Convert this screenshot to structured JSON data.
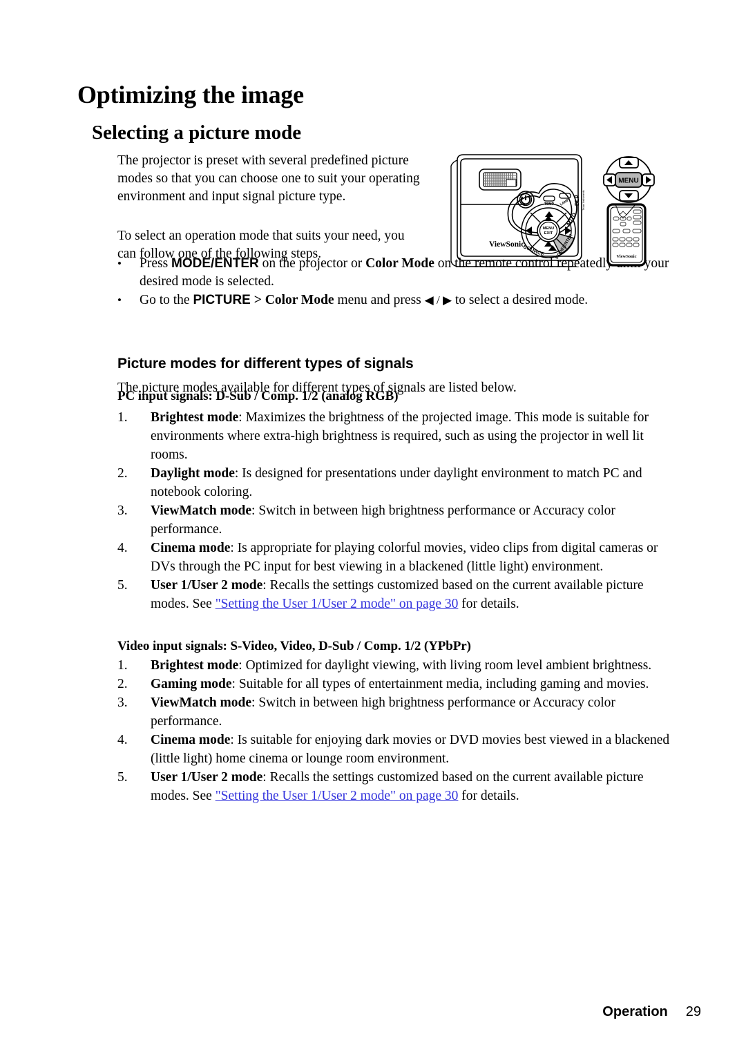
{
  "page": {
    "title": "Optimizing the image",
    "section_title": "Selecting a picture mode",
    "footer_label": "Operation",
    "footer_page": "29"
  },
  "intro": {
    "paragraph1": "The projector is preset with several predefined picture modes so that you can choose one to suit your operating environment and input signal picture type.",
    "paragraph2": "To select an operation mode that suits your need, you can follow one of the following steps."
  },
  "bullets": [
    {
      "marker": "•",
      "pre": "Press ",
      "key1": "MODE/ENTER",
      "mid": " on the projector or ",
      "key2": "Color Mode",
      "post": " on the remote control repeatedly until your desired mode is selected."
    },
    {
      "marker": "•",
      "pre": "Go to the ",
      "key1": "PICTURE",
      "mid": " > ",
      "key2": "Color Mode",
      "post": " menu and press ",
      "glyphs": "◀ / ▶",
      "tail": " to select a desired mode."
    }
  ],
  "signals_heading": "Picture modes for different types of signals",
  "signals_intro": "The picture modes available for different types of signals are listed below.",
  "pc_section": {
    "heading": "PC input signals: D-Sub / Comp. 1/2 (analog RGB)",
    "items": [
      {
        "index": "1.",
        "name": "Brightest mode",
        "text": ": Maximizes the brightness of the projected image. This mode is suitable for environments where extra-high brightness is required, such as using the projector in well lit rooms."
      },
      {
        "index": "2.",
        "name": "Daylight mode",
        "text": ": Is designed for presentations under daylight environment to match PC and notebook coloring."
      },
      {
        "index": "3.",
        "name": "ViewMatch mode",
        "text": ": Switch in between high brightness performance or Accuracy color performance."
      },
      {
        "index": "4.",
        "name": "Cinema mode",
        "text": ":  Is appropriate for playing colorful movies, video clips from digital cameras or DVs through the PC input for best viewing in a blackened (little light) environment."
      },
      {
        "index": "5.",
        "name": "User 1/User 2 mode",
        "text": ": Recalls the settings customized based on the current available picture modes. See ",
        "link": "\"Setting the User 1/User 2 mode\" on page 30",
        "text_after": " for details."
      }
    ]
  },
  "video_section": {
    "heading": "Video input signals: S-Video, Video, D-Sub / Comp. 1/2 (YPbPr)",
    "items": [
      {
        "index": "1.",
        "name": "Brightest mode",
        "text": ": Optimized for daylight viewing, with living room level ambient brightness."
      },
      {
        "index": "2.",
        "name": "Gaming mode",
        "text": ": Suitable for all types of entertainment media, including gaming and movies."
      },
      {
        "index": "3.",
        "name": "ViewMatch mode",
        "text": ": Switch in between high brightness performance or Accuracy color performance."
      },
      {
        "index": "4.",
        "name": "Cinema mode",
        "text": ": Is suitable for enjoying dark movies or DVD movies best viewed in a blackened (little light) home cinema or lounge room environment."
      },
      {
        "index": "5.",
        "name": "User 1/User 2 mode",
        "text": ": Recalls the settings customized based on the current available picture modes. See ",
        "link": "\"Setting the User 1/User 2 mode\" on page 30",
        "text_after": " for details."
      }
    ]
  },
  "illustration": {
    "brand": "ViewSonic",
    "remote_brand": "ViewSonic",
    "projector_labels": {
      "power": "⏻",
      "temp": "TEMP",
      "lamp": "LAMP",
      "dlp": "DLP",
      "menu_exit": "MENU EXIT",
      "auto": "AUTO",
      "source": "SOURCE",
      "mode_enter": "MODE/ENTER"
    },
    "remote_callout": {
      "menu": "MENU",
      "up": "▲",
      "down": "▼",
      "left": "◀",
      "right": "▶"
    }
  }
}
